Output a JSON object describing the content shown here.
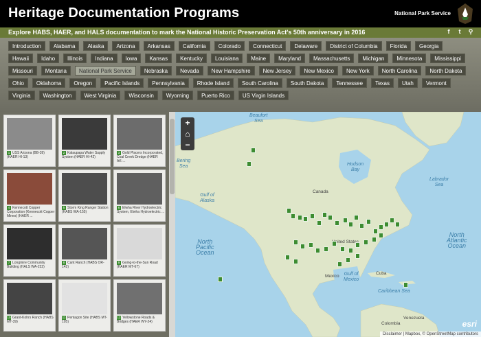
{
  "header": {
    "title": "Heritage Documentation Programs",
    "agency": "National Park Service"
  },
  "subbar": {
    "text": "Explore HABS, HAER, and HALS documentation to mark the National Historic Preservation Act's 50th anniversary in 2016",
    "social": [
      "facebook-icon",
      "twitter-icon",
      "link-icon"
    ]
  },
  "tabs": [
    "Introduction",
    "Alabama",
    "Alaska",
    "Arizona",
    "Arkansas",
    "California",
    "Colorado",
    "Connecticut",
    "Delaware",
    "District of Columbia",
    "Florida",
    "Georgia",
    "Hawaii",
    "Idaho",
    "Illinois",
    "Indiana",
    "Iowa",
    "Kansas",
    "Kentucky",
    "Louisiana",
    "Maine",
    "Maryland",
    "Massachusetts",
    "Michigan",
    "Minnesota",
    "Mississippi",
    "Missouri",
    "Montana",
    "National Park Service",
    "Nebraska",
    "Nevada",
    "New Hampshire",
    "New Jersey",
    "New Mexico",
    "New York",
    "North Carolina",
    "North Dakota",
    "Ohio",
    "Oklahoma",
    "Oregon",
    "Pacific Islands",
    "Pennsylvania",
    "Rhode Island",
    "South Carolina",
    "South Dakota",
    "Tennessee",
    "Texas",
    "Utah",
    "Vermont",
    "Virginia",
    "Washington",
    "West Virginia",
    "Wisconsin",
    "Wyoming",
    "Puerto Rico",
    "US Virgin Islands"
  ],
  "active_tab": "National Park Service",
  "cards": [
    {
      "num": "1",
      "caption": "USS Arizona (BB-39) (HAER HI-13)"
    },
    {
      "num": "2",
      "caption": "Kalaupapa Water Supply System (HAER HI-42)"
    },
    {
      "num": "3",
      "caption": "Gold Placers Incorporated, Coal Creek Dredge (HAER AK-..."
    },
    {
      "num": "4",
      "caption": "Kennecott Copper Corporation (Kennecott Copper Mines) (HAER ..."
    },
    {
      "num": "5",
      "caption": "Storm King Ranger Station (HABS WA-155)"
    },
    {
      "num": "6",
      "caption": "Elwha River Hydroelectric System, Elwha Hydroelectric ..."
    },
    {
      "num": "7",
      "caption": "Longmire Community Building (HALS WA-222)"
    },
    {
      "num": "8",
      "caption": "Cant Ranch (HABS OR-142)"
    },
    {
      "num": "9",
      "caption": "Going-to-the-Sun Road (HAER MT-67)"
    },
    {
      "num": "10",
      "caption": "Grant-Kohrs Ranch (HABS MT-39)"
    },
    {
      "num": "11",
      "caption": "Pentagon Site (HABS MT-105)"
    },
    {
      "num": "12",
      "caption": "Yellowstone Roads & Bridges (HAER WY-24)"
    }
  ],
  "map": {
    "zoom_in": "+",
    "home": "⌂",
    "zoom_out": "−",
    "labels": {
      "beaufort": "Beaufort\nSea",
      "bering": "Bering\nSea",
      "gulf_alaska": "Gulf of\nAlaska",
      "hudson": "Hudson\nBay",
      "labrador": "Labrador\nSea",
      "north_pacific": "North\nPacific\nOcean",
      "north_atlantic": "North\nAtlantic\nOcean",
      "gulf_mexico": "Gulf of\nMexico",
      "caribbean": "Caribbean Sea",
      "canada": "Canada",
      "united_states": "United States",
      "mexico": "Mexico",
      "cuba": "Cuba",
      "venezuela": "Venezuela",
      "colombia": "Colombia"
    },
    "attribution": "Disclaimer | Mapbox, © OpenStreetMap contributors",
    "esri": "esri"
  },
  "colors": {
    "header": "#000000",
    "subbar": "#6a7a37",
    "marker": "#3d8c31",
    "water": "#a8d3ea",
    "land": "#dfe6c9"
  }
}
